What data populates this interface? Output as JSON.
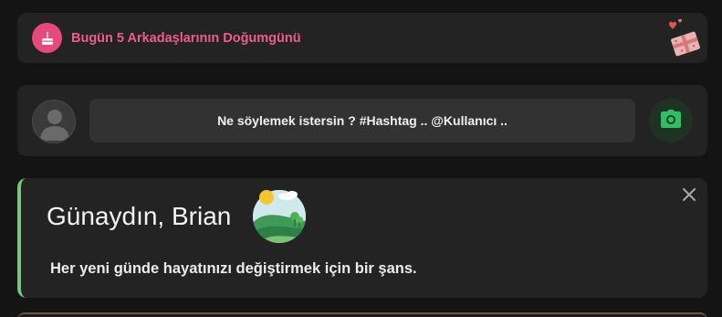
{
  "birthday": {
    "text": "Bugün 5 Arkadaşlarının Doğumgünü",
    "icon": "birthday-cake-icon",
    "decoration_icon": "gift-hearts-icon",
    "accent": "#e8497d"
  },
  "composer": {
    "placeholder": "Ne söylemek istersin ? #Hashtag .. @Kullanıcı ..",
    "camera_icon": "camera-icon",
    "camera_color": "#2fbf64"
  },
  "greeting": {
    "title": "Günaydın, Brian",
    "subtitle": "Her yeni günde hayatınızı değiştirmek için bir şans.",
    "illustration_icon": "morning-landscape-icon",
    "close_icon": "close-icon",
    "border_color": "#7ac77a"
  }
}
